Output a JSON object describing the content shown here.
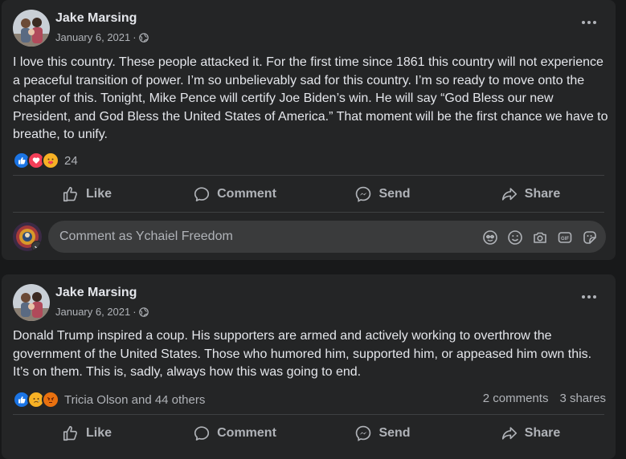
{
  "posts": [
    {
      "author": "Jake Marsing",
      "date": "January 6, 2021",
      "separator": "·",
      "text": "I love this country. These people attacked it. For the first time since 1861 this country will not experience a peaceful transition of power. I’m so unbelievably sad for this country. I’m so ready to move onto the chapter of this. Tonight, Mike Pence will certify Joe Biden’s win. He will say “God Bless our new President, and God Bless the United States of America.” That moment will be the first chance we have to breathe, to unify.",
      "reactions": [
        "like",
        "love",
        "care"
      ],
      "reaction_count": "24",
      "actions": {
        "like": "Like",
        "comment": "Comment",
        "send": "Send",
        "share": "Share"
      },
      "comment_placeholder": "Comment as Ychaiel Freedom"
    },
    {
      "author": "Jake Marsing",
      "date": "January 6, 2021",
      "separator": "·",
      "text": "Donald Trump inspired a coup. His supporters are armed and actively working to overthrow the government of the United States. Those who humored him, supported him, or appeased him own this. It’s on them. This is, sadly, always how this was going to end.",
      "reactions": [
        "like",
        "sad",
        "angry"
      ],
      "reaction_count": "Tricia Olson and 44 others",
      "comments_count": "2 comments",
      "shares_count": "3 shares",
      "actions": {
        "like": "Like",
        "comment": "Comment",
        "send": "Send",
        "share": "Share"
      }
    }
  ],
  "icons": {
    "comment_tools": [
      "avatar-sticker-icon",
      "emoji-icon",
      "camera-icon",
      "gif-icon",
      "sticker-icon"
    ]
  },
  "colors": {
    "background": "#18191a",
    "card": "#242526",
    "primary_text": "#e4e6eb",
    "secondary_text": "#b0b3b8",
    "like_blue": "#1b74e4",
    "love_red": "#f33e58",
    "reaction_yellow": "#f7b125"
  }
}
